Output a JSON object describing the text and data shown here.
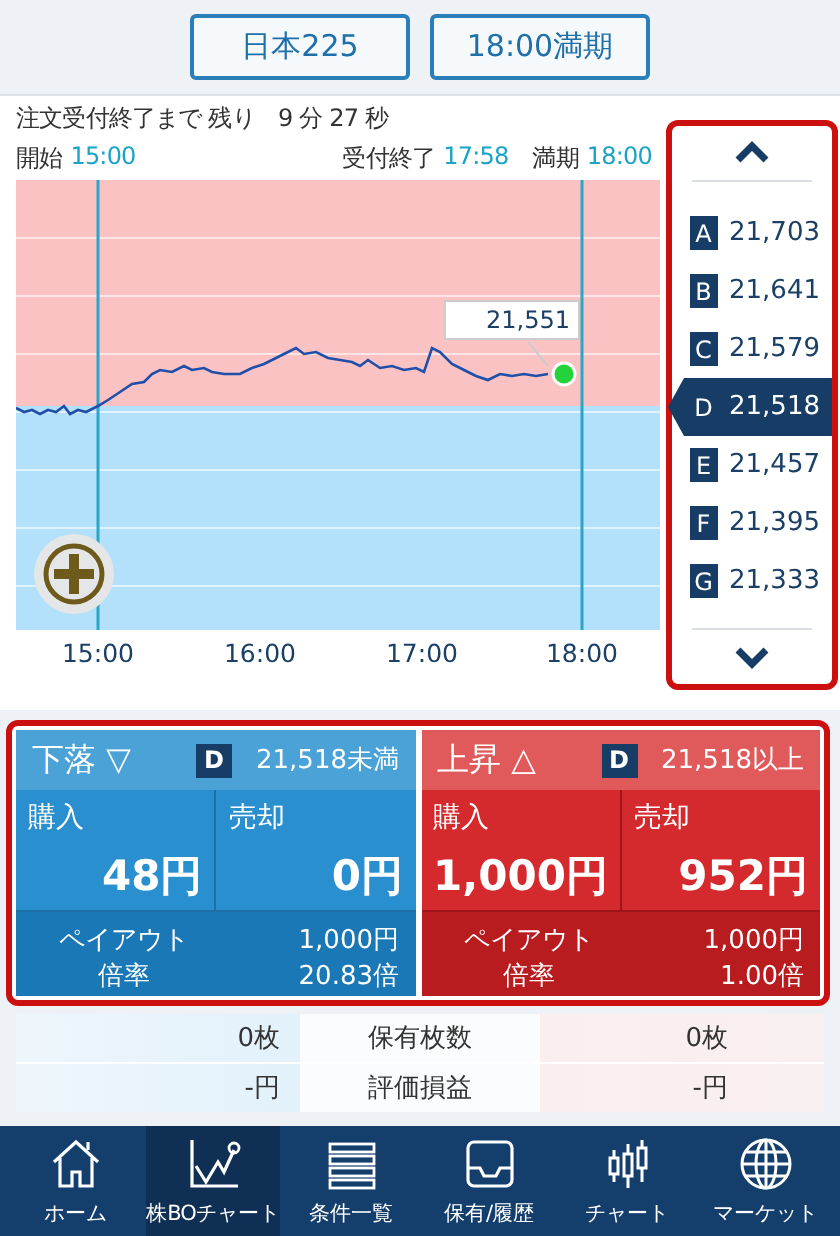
{
  "header_buttons": [
    "日本225",
    "18:00満期"
  ],
  "countdown": "注文受付終了まで 残り　9 分 27 秒",
  "times": [
    {
      "label": "開始",
      "value": "15:00"
    },
    {
      "label": "受付終了",
      "value": "17:58"
    },
    {
      "label": "満期",
      "value": "18:00"
    }
  ],
  "chart": {
    "tooltip": "21,551",
    "x_labels": [
      "15:00",
      "16:00",
      "17:00",
      "18:00"
    ]
  },
  "strikes": [
    {
      "letter": "A",
      "price": "21,703",
      "selected": false
    },
    {
      "letter": "B",
      "price": "21,641",
      "selected": false
    },
    {
      "letter": "C",
      "price": "21,579",
      "selected": false
    },
    {
      "letter": "D",
      "price": "21,518",
      "selected": true
    },
    {
      "letter": "E",
      "price": "21,457",
      "selected": false
    },
    {
      "letter": "F",
      "price": "21,395",
      "selected": false
    },
    {
      "letter": "G",
      "price": "21,333",
      "selected": false
    }
  ],
  "trade": [
    {
      "kind": "down",
      "direction": "下落",
      "arrow": "▽",
      "strike_letter": "D",
      "condition": "21,518未満",
      "buy_label": "購入",
      "buy_price": "48円",
      "sell_label": "売却",
      "sell_price": "0円",
      "payout_label": "ペイアウト",
      "payout": "1,000円",
      "rate_label": "倍率",
      "rate": "20.83倍"
    },
    {
      "kind": "up",
      "direction": "上昇",
      "arrow": "△",
      "strike_letter": "D",
      "condition": "21,518以上",
      "buy_label": "購入",
      "buy_price": "1,000円",
      "sell_label": "売却",
      "sell_price": "952円",
      "payout_label": "ペイアウト",
      "payout": "1,000円",
      "rate_label": "倍率",
      "rate": "1.00倍"
    }
  ],
  "holdings": [
    {
      "label": "保有枚数",
      "left": "0枚",
      "right": "0枚"
    },
    {
      "label": "評価損益",
      "left": "-円",
      "right": "-円"
    }
  ],
  "nav": [
    {
      "label": "ホーム",
      "selected": false
    },
    {
      "label": "株BOチャート",
      "selected": true
    },
    {
      "label": "条件一覧",
      "selected": false
    },
    {
      "label": "保有/履歴",
      "selected": false
    },
    {
      "label": "チャート",
      "selected": false
    },
    {
      "label": "マーケット",
      "selected": false
    }
  ]
}
